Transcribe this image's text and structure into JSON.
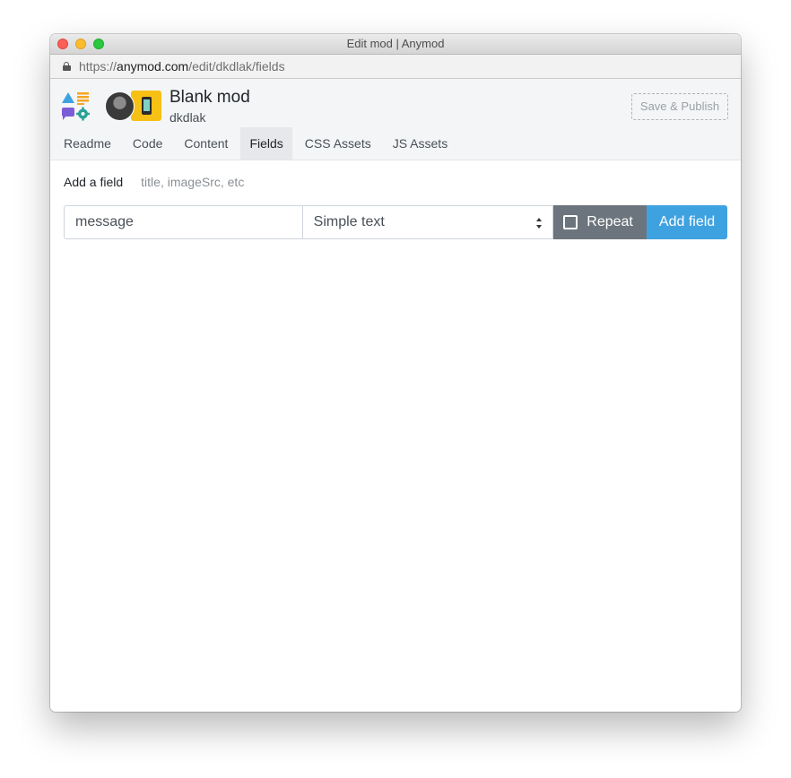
{
  "window": {
    "title": "Edit mod | Anymod",
    "url_scheme": "https://",
    "url_host": "anymod.com",
    "url_path": "/edit/dkdlak/fields"
  },
  "header": {
    "mod_title": "Blank mod",
    "owner": "dkdlak",
    "publish_label": "Save & Publish"
  },
  "tabs": [
    {
      "label": "Readme"
    },
    {
      "label": "Code"
    },
    {
      "label": "Content"
    },
    {
      "label": "Fields",
      "active": true
    },
    {
      "label": "CSS Assets"
    },
    {
      "label": "JS Assets"
    }
  ],
  "add_field": {
    "label": "Add a field",
    "hint": "title, imageSrc, etc",
    "name_value": "message",
    "type_selected": "Simple text",
    "repeat_label": "Repeat",
    "repeat_checked": false,
    "submit_label": "Add field"
  },
  "colors": {
    "accent": "#3fa2e0",
    "repeat_bg": "#6c757d",
    "logo_blue": "#3fa2e0",
    "logo_orange": "#f5a623",
    "logo_purple": "#7b5cd6",
    "logo_teal": "#2aa198"
  }
}
